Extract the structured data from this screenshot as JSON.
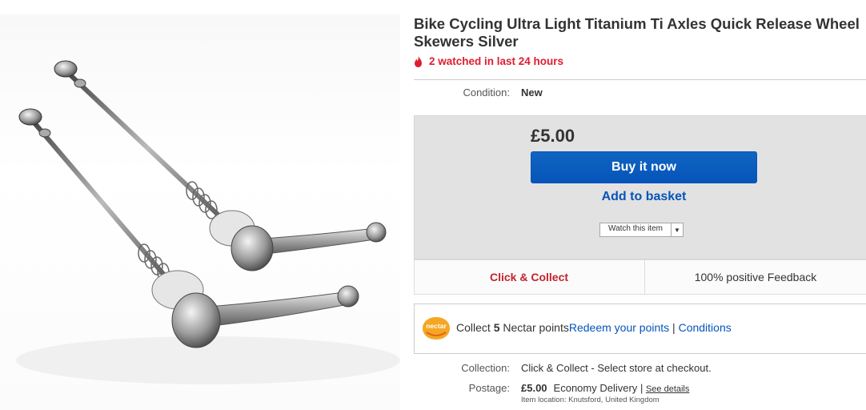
{
  "product": {
    "title": "Bike Cycling Ultra Light Titanium Ti Axles Quick Release Wheel Skewers Silver",
    "watched": "2 watched in last 24 hours",
    "condition_label": "Condition:",
    "condition_value": "New"
  },
  "buy_box": {
    "price": "£5.00",
    "buy_now_label": "Buy it now",
    "add_to_basket_label": "Add to basket",
    "watch_label": "Watch this item"
  },
  "badges": {
    "click_collect": "Click & Collect",
    "feedback": "100% positive Feedback"
  },
  "nectar": {
    "logo_text": "nectar",
    "collect_prefix": "Collect",
    "points": "5",
    "points_suffix": "Nectar points",
    "redeem_link": "Redeem your points",
    "separator": "|",
    "conditions_link": "Conditions"
  },
  "collection": {
    "label": "Collection:",
    "value": "Click & Collect - Select store at checkout."
  },
  "postage": {
    "label": "Postage:",
    "price": "£5.00",
    "method": "Economy Delivery",
    "separator": "|",
    "details_link": "See details",
    "item_location": "Item location:  Knutsford, United Kingdom"
  },
  "colors": {
    "accent_blue": "#0654ba",
    "watch_red": "#dd1e31",
    "collect_red": "#c2232d",
    "buy_box_bg": "#e2e2e2",
    "nectar_orange": "#f5a623"
  },
  "icons": {
    "flame": "flame-icon",
    "dropdown": "chevron-down-icon",
    "nectar": "nectar-logo"
  }
}
